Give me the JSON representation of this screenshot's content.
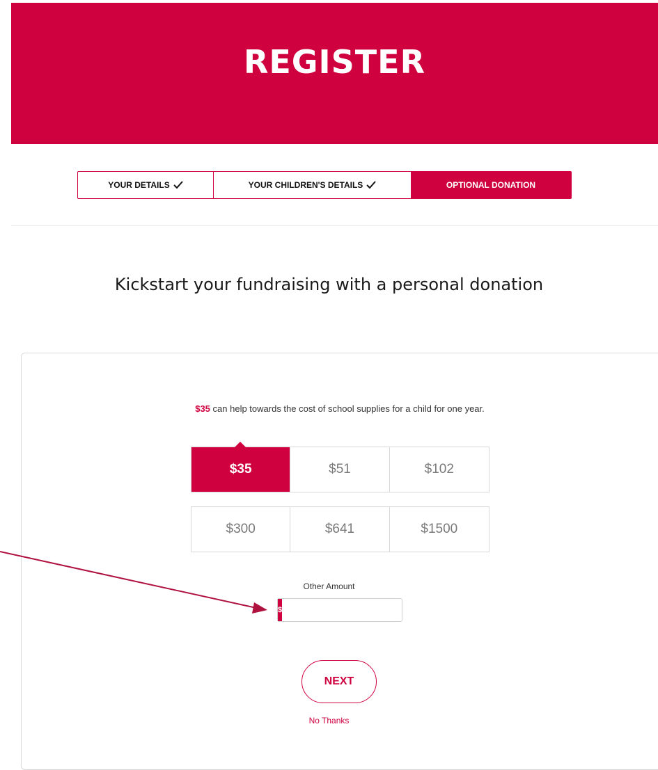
{
  "banner": {
    "title": "REGISTER"
  },
  "steps": [
    {
      "label": "YOUR DETAILS",
      "complete": true
    },
    {
      "label": "YOUR CHILDREN'S DETAILS",
      "complete": true
    },
    {
      "label": "OPTIONAL DONATION",
      "active": true
    }
  ],
  "heading": "Kickstart your fundraising with a personal donation",
  "blurb": {
    "amount": "$35",
    "text": " can help towards the cost of school supplies for a child for one year."
  },
  "amounts": {
    "row1": [
      "$35",
      "$51",
      "$102"
    ],
    "row2": [
      "$300",
      "$641",
      "$1500"
    ],
    "selected": "$35"
  },
  "other": {
    "label": "Other Amount",
    "prefix": "$",
    "value": ""
  },
  "buttons": {
    "next": "NEXT",
    "no_thanks": "No Thanks"
  },
  "colors": {
    "brand": "#d0013f"
  }
}
